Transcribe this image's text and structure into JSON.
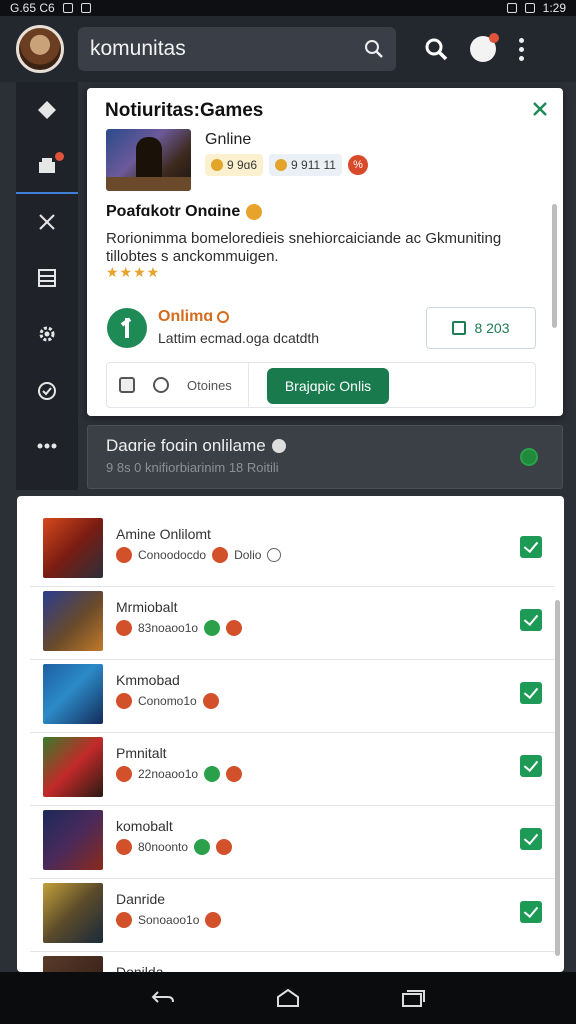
{
  "statusbar": {
    "left": "G.65 C6",
    "right": "1:29"
  },
  "appbar": {
    "search_text": "komunitas"
  },
  "card": {
    "title": "Notiuritas:Games",
    "game_name": "Gnline",
    "chip1": "9 9ɑ6",
    "chip2": "9 911 11",
    "chip3": "%",
    "subtitle": "Poafɑkotr Onɑine",
    "description": "Rorionimma bomeloredieis snehiorcaiciande ac Gkmuniting tillobtes s anckommuigen.",
    "stars": "★★★★",
    "online_label": "Onlimɑ",
    "online_sub": "Lattim ecmad.oga dcatdth",
    "stat_value": "8 203",
    "pill_label": "Otoines",
    "green_button": "Brajɑpic Onlis"
  },
  "strip": {
    "title": "Daɑrie foɑin onlilame",
    "sub": "9 8s 0 knifiorbiarinim 18 Roitili"
  },
  "list": [
    {
      "title": "Amine Onlilomt",
      "meta1": "Conoodocdo",
      "meta2": "Dolio"
    },
    {
      "title": "Mrmiobalt",
      "meta1": "83noaoo1o",
      "meta2": ""
    },
    {
      "title": "Kmmobad",
      "meta1": "Conomo1o",
      "meta2": ""
    },
    {
      "title": "Pmnitalt",
      "meta1": "22noaoo1o",
      "meta2": ""
    },
    {
      "title": "komobalt",
      "meta1": "80noonto",
      "meta2": ""
    },
    {
      "title": "Danride",
      "meta1": "Sonoaoo1o",
      "meta2": ""
    },
    {
      "title": "Donilda",
      "meta1": "",
      "meta2": ""
    }
  ]
}
